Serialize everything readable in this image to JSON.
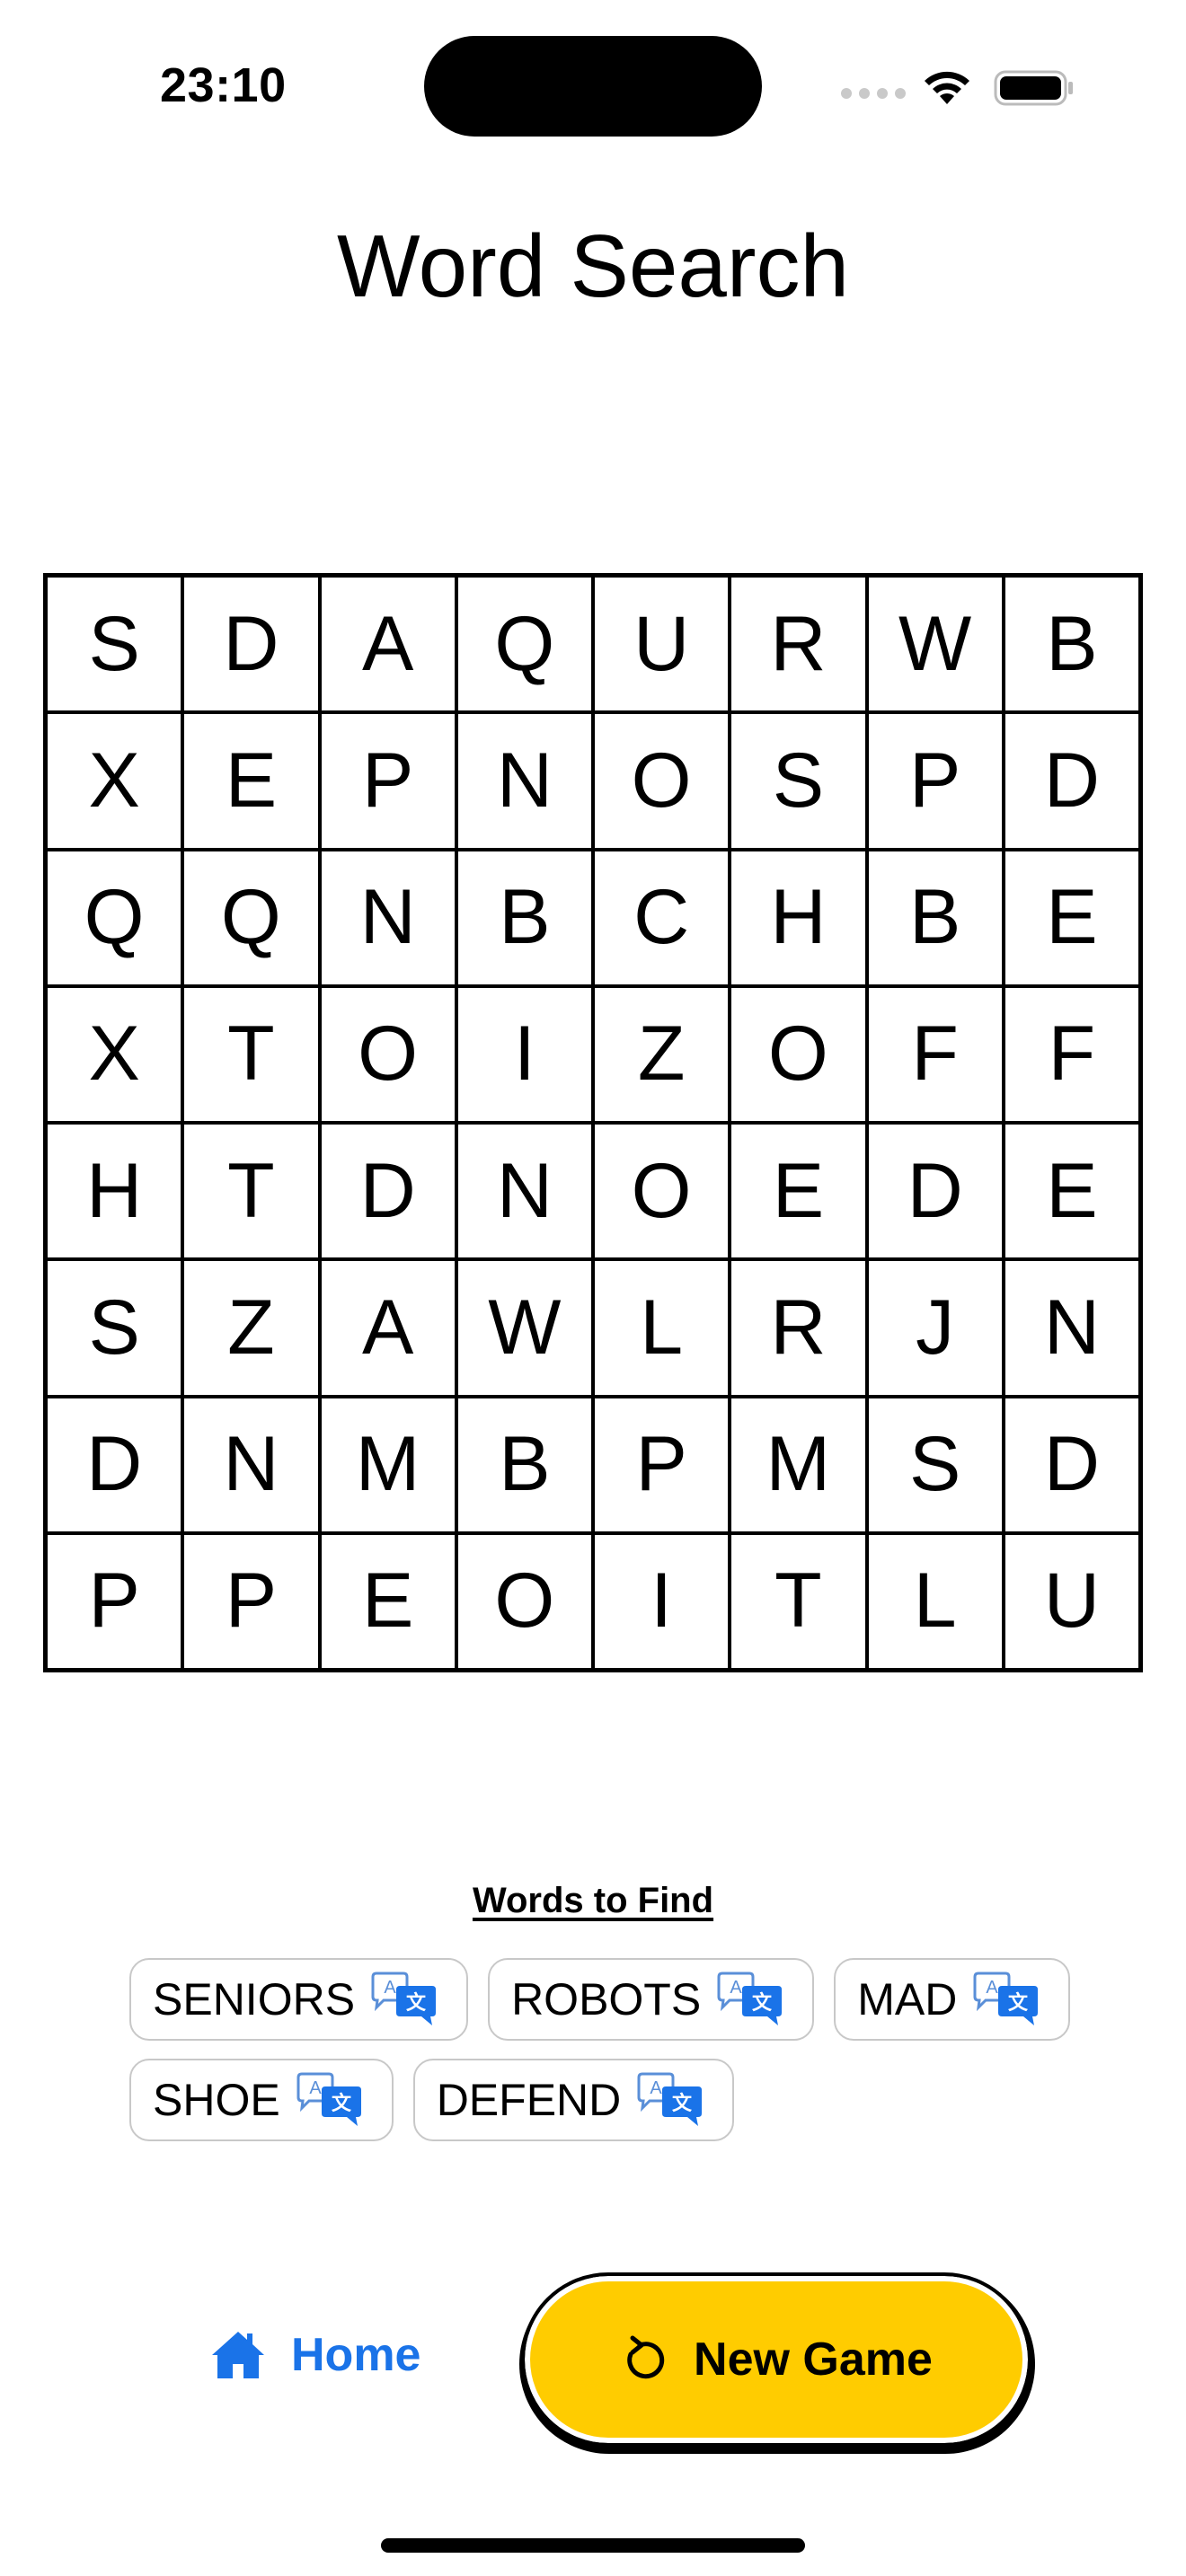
{
  "status_bar": {
    "time": "23:10"
  },
  "title": "Word Search",
  "grid": [
    [
      "S",
      "D",
      "A",
      "Q",
      "U",
      "R",
      "W",
      "B"
    ],
    [
      "X",
      "E",
      "P",
      "N",
      "O",
      "S",
      "P",
      "D"
    ],
    [
      "Q",
      "Q",
      "N",
      "B",
      "C",
      "H",
      "B",
      "E"
    ],
    [
      "X",
      "T",
      "O",
      "I",
      "Z",
      "O",
      "F",
      "F"
    ],
    [
      "H",
      "T",
      "D",
      "N",
      "O",
      "E",
      "D",
      "E"
    ],
    [
      "S",
      "Z",
      "A",
      "W",
      "L",
      "R",
      "J",
      "N"
    ],
    [
      "D",
      "N",
      "M",
      "B",
      "P",
      "M",
      "S",
      "D"
    ],
    [
      "P",
      "P",
      "E",
      "O",
      "I",
      "T",
      "L",
      "U"
    ]
  ],
  "words_title": "Words to Find",
  "words": [
    "SENIORS",
    "ROBOTS",
    "MAD",
    "SHOE",
    "DEFEND"
  ],
  "bottom": {
    "home_label": "Home",
    "new_game_label": "New Game"
  },
  "colors": {
    "accent": "#1a73e8",
    "button": "#ffcc00"
  },
  "icons": {
    "home": "house-icon",
    "new_game": "rotate-ccw-icon",
    "word": "translate-icon"
  }
}
